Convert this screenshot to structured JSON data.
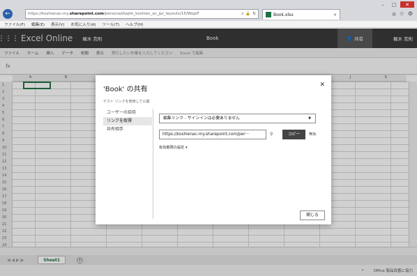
{
  "browser": {
    "address_prefix": "https://koshienac-my.",
    "address_domain": "sharepoint.com",
    "address_rest": "/personal/kajiki_koshien_ac_jp/_layouts/15/WopiF",
    "tab_title": "Book.xlsx",
    "menu": [
      "ファイル(F)",
      "編集(E)",
      "表示(V)",
      "お気に入り(A)",
      "ツール(T)",
      "ヘルプ(H)"
    ]
  },
  "excel": {
    "app_name": "Excel Online",
    "user": "梶木 克則",
    "book": "Book",
    "share_label": "共有",
    "user_right": "梶木 克則",
    "ribbon_tabs": [
      "ファイル",
      "ホーム",
      "挿入",
      "データ",
      "校閲",
      "表示"
    ],
    "tell_me": "実行したい作業を入力してください",
    "open_in_excel": "Excel で編集",
    "formula_fx": "fx",
    "columns": [
      "A",
      "B",
      "C",
      "D",
      "E",
      "F",
      "G",
      "H",
      "I",
      "J",
      "K"
    ],
    "rows": [
      "1",
      "2",
      "3",
      "4",
      "5",
      "6",
      "7",
      "8",
      "9",
      "10",
      "11",
      "12",
      "13",
      "14",
      "15",
      "16",
      "17",
      "18",
      "19",
      "20",
      "21",
      "22",
      "23",
      "24"
    ],
    "sheet_tab": "Sheet1",
    "status_text": "Office 製品改善に協力"
  },
  "dialog": {
    "title": "'Book' の共有",
    "subtitle": "ゲスト リンクを使用して公開",
    "nav": [
      "ユーザーの招待",
      "リンクを取得",
      "共有相手"
    ],
    "permission_select": "編集リンク - サインインは必要ありません",
    "link_url": "https://koshienac-my.sharepoint.com/per···",
    "copy_label": "コピー",
    "disable_label": "無効",
    "expiry_label": "有効期限の設定 ▾",
    "close_label": "閉じる"
  }
}
